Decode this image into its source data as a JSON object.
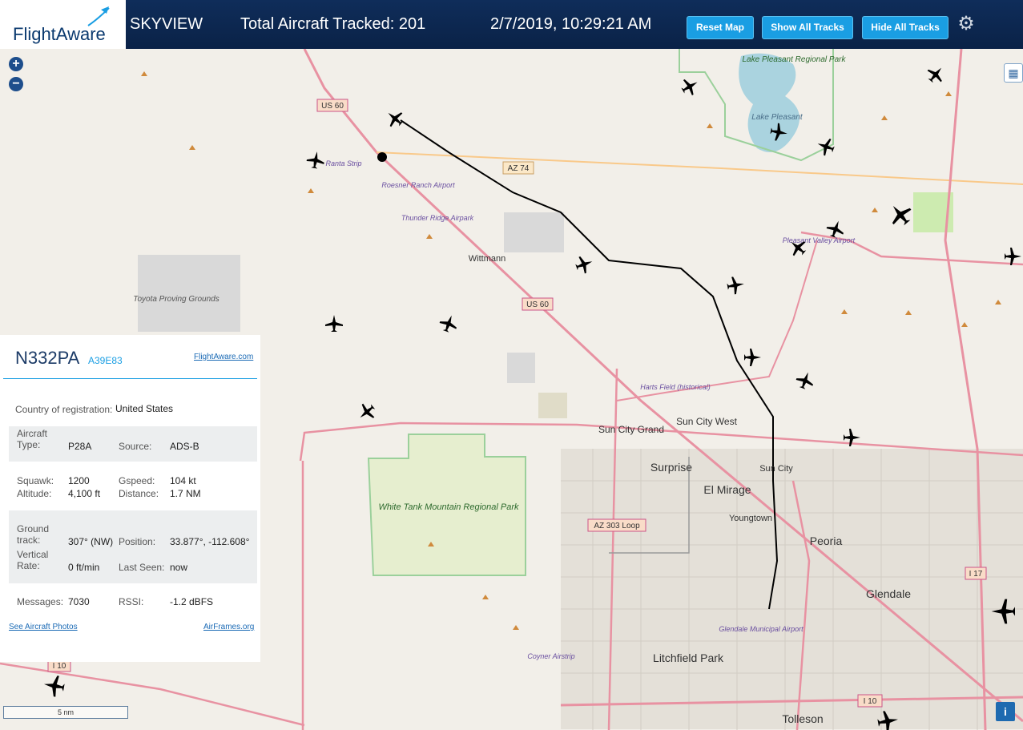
{
  "header": {
    "logo_text": "FlightAware",
    "app_name": "SKYVIEW",
    "tracked_label": "Total Aircraft Tracked: 201",
    "datetime": "2/7/2019, 10:29:21 AM",
    "reset_map": "Reset Map",
    "show_tracks": "Show All Tracks",
    "hide_tracks": "Hide All Tracks",
    "accent": "#1a9ee3",
    "bar_color": "#0f2d5a"
  },
  "map": {
    "zoom_in": "+",
    "zoom_out": "−",
    "scale": "5 nm",
    "places": [
      "Wittmann",
      "Sun City West",
      "Sun City Grand",
      "Surprise",
      "El Mirage",
      "Sun City",
      "Youngtown",
      "Peoria",
      "Glendale",
      "Litchfield Park",
      "Tolleson"
    ],
    "parks": [
      "Lake Pleasant Regional Park",
      "White Tank Mountain Regional Park",
      "Toyota Proving Grounds",
      "Lake Pleasant"
    ],
    "airports": [
      "Ranta Strip",
      "Roesner Ranch Airport",
      "Thunder Ridge Airpark",
      "Pleasant Valley Airport",
      "Harts Field (historical)",
      "Glendale Municipal Airport",
      "Coyner Airstrip"
    ],
    "shields": [
      "US 60",
      "AZ 74",
      "US 60",
      "AZ 303 Loop",
      "I 10",
      "I 17",
      "I 10"
    ]
  },
  "aircraft": {
    "callsign": "N332PA",
    "hex": "A39E83",
    "link": "FlightAware.com",
    "country_label": "Country of registration:",
    "country": "United States",
    "type_label": "Aircraft Type:",
    "type": "P28A",
    "source_label": "Source:",
    "source": "ADS-B",
    "squawk_label": "Squawk:",
    "squawk": "1200",
    "gspeed_label": "Gspeed:",
    "gspeed": "104 kt",
    "altitude_label": "Altitude:",
    "altitude": "4,100 ft",
    "distance_label": "Distance:",
    "distance": "1.7 NM",
    "track_label": "Ground track:",
    "track": "307° (NW)",
    "position_label": "Position:",
    "position": "33.877°, -112.608°",
    "vrate_label": "Vertical Rate:",
    "vrate": "0 ft/min",
    "seen_label": "Last Seen:",
    "seen": "now",
    "messages_label": "Messages:",
    "messages": "7030",
    "rssi_label": "RSSI:",
    "rssi": "-1.2 dBFS",
    "photos_link": "See Aircraft Photos",
    "airframes_link": "AirFrames.org"
  }
}
